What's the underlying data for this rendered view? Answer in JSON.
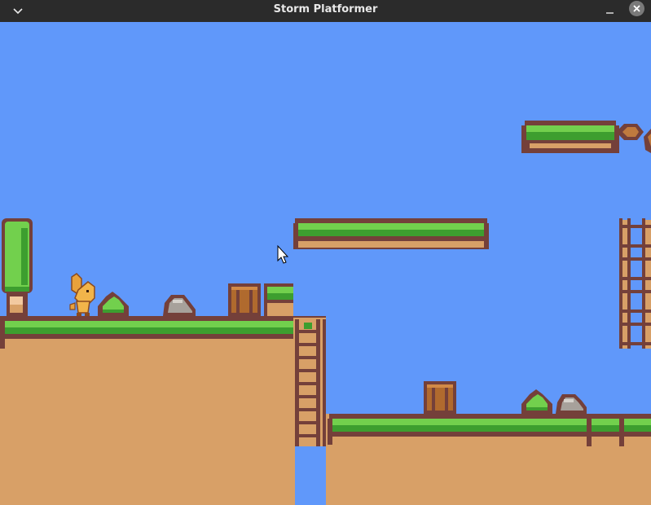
{
  "window": {
    "title": "Storm Platformer",
    "controls": [
      "menu-chevron",
      "minimize",
      "close"
    ]
  },
  "colors": {
    "sky": "#6098fa",
    "dirt": "#d8a067",
    "outline": "#74403a",
    "grass_light": "#72d04d",
    "grass_dark": "#3d9e2f",
    "titlebar": "#2b2b2b",
    "close_button": "#7a7a7a"
  },
  "scene": {
    "player": "orange-bunny",
    "props": [
      "tall-bush",
      "small-bush",
      "rock",
      "crate",
      "crate",
      "small-bush",
      "rock"
    ],
    "climbables": [
      "ladder",
      "rope-fence"
    ],
    "cursor": "arrow-pointer"
  }
}
